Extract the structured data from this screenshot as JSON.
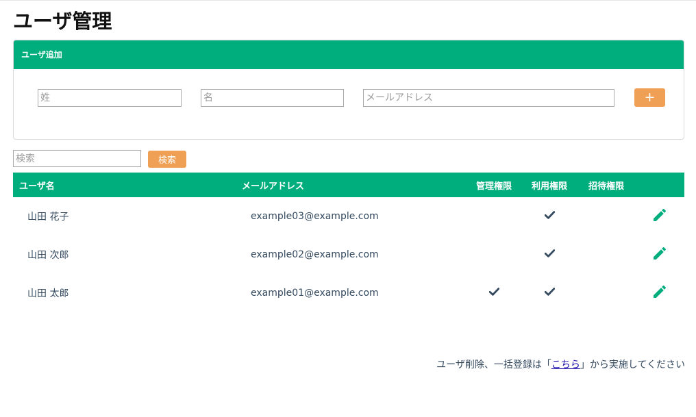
{
  "page": {
    "title": "ユーザ管理"
  },
  "add_user": {
    "header": "ユーザ追加",
    "last_name_placeholder": "姓",
    "first_name_placeholder": "名",
    "email_placeholder": "メールアドレス",
    "add_button_label": "+"
  },
  "search": {
    "placeholder": "検索",
    "button_label": "検索"
  },
  "table": {
    "columns": [
      "ユーザ名",
      "メールアドレス",
      "管理権限",
      "利用権限",
      "招待権限"
    ],
    "rows": [
      {
        "name": "山田 花子",
        "email": "example03@example.com",
        "admin": false,
        "use": true,
        "invite": false
      },
      {
        "name": "山田 次郎",
        "email": "example02@example.com",
        "admin": false,
        "use": true,
        "invite": false
      },
      {
        "name": "山田 太郎",
        "email": "example01@example.com",
        "admin": true,
        "use": true,
        "invite": false
      }
    ],
    "check_icon": "check-icon",
    "edit_icon": "pencil-icon"
  },
  "footer": {
    "prefix": "ユーザ削除、一括登録は「",
    "link_text": "こちら",
    "suffix": "」から実施してください"
  },
  "colors": {
    "accent": "#00ae7d",
    "button": "#f0a055",
    "text": "#34495e"
  }
}
